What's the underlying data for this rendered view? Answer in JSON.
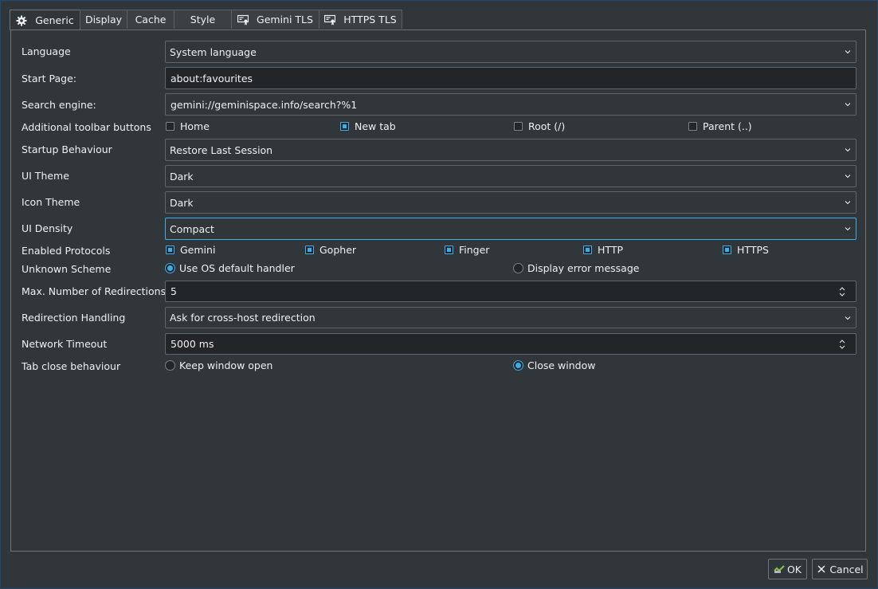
{
  "tabs": [
    {
      "label": "Generic",
      "icon": "gear-icon"
    },
    {
      "label": "Display"
    },
    {
      "label": "Cache"
    },
    {
      "label": "Style"
    },
    {
      "label": "Gemini TLS",
      "icon": "certificate-icon"
    },
    {
      "label": "HTTPS TLS",
      "icon": "certificate-icon"
    }
  ],
  "form": {
    "language": {
      "label": "Language",
      "value": "System language"
    },
    "start_page": {
      "label": "Start Page:",
      "value": "about:favourites"
    },
    "search_engine": {
      "label": "Search engine:",
      "value": "gemini://geminispace.info/search?%1"
    },
    "toolbar_buttons": {
      "label": "Additional toolbar buttons",
      "options": [
        {
          "label": "Home",
          "checked": false
        },
        {
          "label": "New tab",
          "checked": true
        },
        {
          "label": "Root (/)",
          "checked": false
        },
        {
          "label": "Parent (..)",
          "checked": false
        }
      ]
    },
    "startup": {
      "label": "Startup Behaviour",
      "value": "Restore Last Session"
    },
    "ui_theme": {
      "label": "UI Theme",
      "value": "Dark"
    },
    "icon_theme": {
      "label": "Icon Theme",
      "value": "Dark"
    },
    "ui_density": {
      "label": "UI Density",
      "value": "Compact"
    },
    "protocols": {
      "label": "Enabled Protocols",
      "options": [
        {
          "label": "Gemini",
          "checked": true
        },
        {
          "label": "Gopher",
          "checked": true
        },
        {
          "label": "Finger",
          "checked": true
        },
        {
          "label": "HTTP",
          "checked": true
        },
        {
          "label": "HTTPS",
          "checked": true
        }
      ]
    },
    "unknown_scheme": {
      "label": "Unknown Scheme",
      "options": [
        {
          "label": "Use OS default handler",
          "selected": true
        },
        {
          "label": "Display error message",
          "selected": false
        }
      ]
    },
    "max_redirections": {
      "label": "Max. Number of Redirections",
      "value": "5"
    },
    "redirection_handling": {
      "label": "Redirection Handling",
      "value": "Ask for cross-host redirection"
    },
    "network_timeout": {
      "label": "Network Timeout",
      "value": "5000 ms"
    },
    "tab_close": {
      "label": "Tab close behaviour",
      "options": [
        {
          "label": "Keep window open",
          "selected": false
        },
        {
          "label": "Close window",
          "selected": true
        }
      ]
    }
  },
  "buttons": {
    "ok": "OK",
    "cancel": "Cancel"
  },
  "colors": {
    "accent": "#3daee9",
    "background": "#31363b",
    "input_background": "#232629"
  }
}
